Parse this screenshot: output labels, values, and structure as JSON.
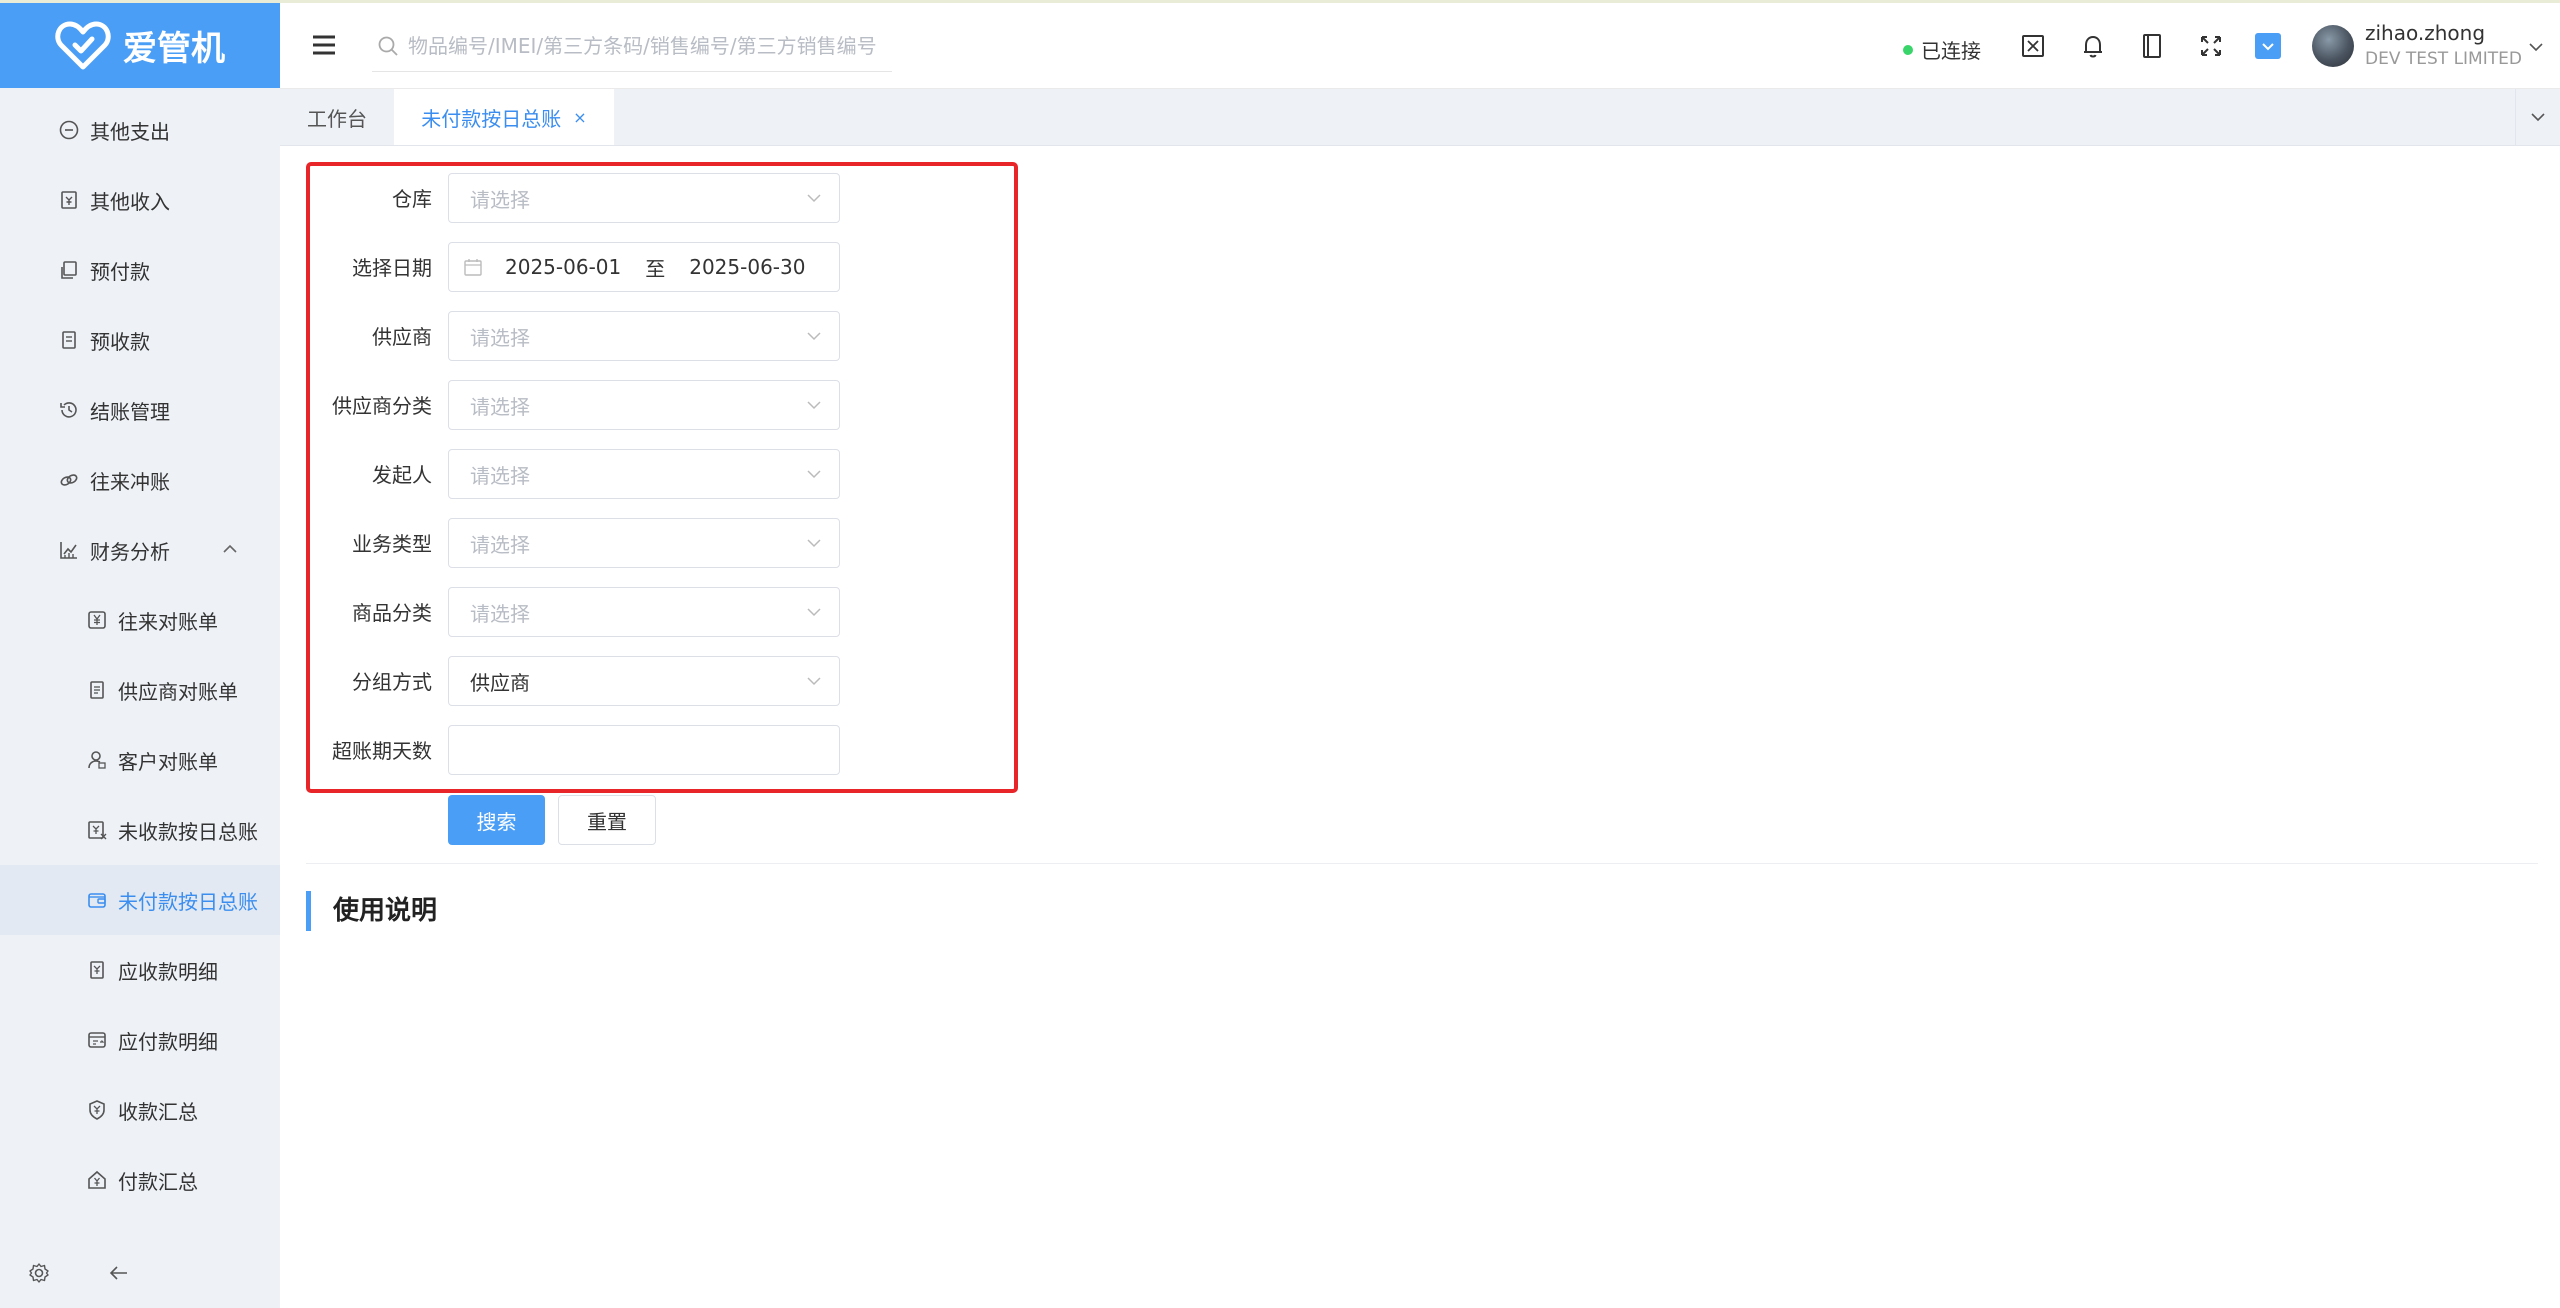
{
  "app": {
    "logo_text": "爱管机"
  },
  "sidebar": {
    "items": [
      {
        "label": "其他支出",
        "icon": "minus-circle-icon"
      },
      {
        "label": "其他收入",
        "icon": "receipt-icon"
      },
      {
        "label": "预付款",
        "icon": "prepay-icon"
      },
      {
        "label": "预收款",
        "icon": "document-icon"
      },
      {
        "label": "结账管理",
        "icon": "history-icon"
      },
      {
        "label": "往来冲账",
        "icon": "link-icon"
      },
      {
        "label": "财务分析",
        "icon": "chart-icon",
        "expanded": true
      }
    ],
    "subitems": [
      {
        "label": "往来对账单",
        "icon": "yen-icon"
      },
      {
        "label": "供应商对账单",
        "icon": "bill-icon"
      },
      {
        "label": "客户对账单",
        "icon": "user-icon"
      },
      {
        "label": "未收款按日总账",
        "icon": "yen-x-icon"
      },
      {
        "label": "未付款按日总账",
        "icon": "wallet-icon",
        "active": true
      },
      {
        "label": "应收款明细",
        "icon": "receivable-icon"
      },
      {
        "label": "应付款明细",
        "icon": "payable-icon"
      },
      {
        "label": "收款汇总",
        "icon": "shield-yen-icon"
      },
      {
        "label": "付款汇总",
        "icon": "house-yen-icon"
      }
    ]
  },
  "header": {
    "search_placeholder": "物品编号/IMEI/第三方条码/销售编号/第三方销售编号",
    "status_text": "已连接",
    "user_name": "zihao.zhong",
    "company": "DEV TEST LIMITED"
  },
  "tabs": [
    {
      "label": "工作台"
    },
    {
      "label": "未付款按日总账",
      "active": true,
      "close": "×"
    }
  ],
  "form": {
    "warehouse": {
      "label": "仓库",
      "placeholder": "请选择"
    },
    "date": {
      "label": "选择日期",
      "start": "2025-06-01",
      "sep": "至",
      "end": "2025-06-30"
    },
    "supplier": {
      "label": "供应商",
      "placeholder": "请选择"
    },
    "supplier_category": {
      "label": "供应商分类",
      "placeholder": "请选择"
    },
    "initiator": {
      "label": "发起人",
      "placeholder": "请选择"
    },
    "business_type": {
      "label": "业务类型",
      "placeholder": "请选择"
    },
    "product_category": {
      "label": "商品分类",
      "placeholder": "请选择"
    },
    "group_by": {
      "label": "分组方式",
      "value": "供应商"
    },
    "overdue_days": {
      "label": "超账期天数",
      "value": ""
    },
    "search_button": "搜索",
    "reset_button": "重置"
  },
  "section": {
    "title": "使用说明"
  },
  "colors": {
    "accent": "#4a9ef5",
    "active_text": "#3b8ef0",
    "highlight": "#e8262a",
    "connected": "#3ad56a"
  }
}
